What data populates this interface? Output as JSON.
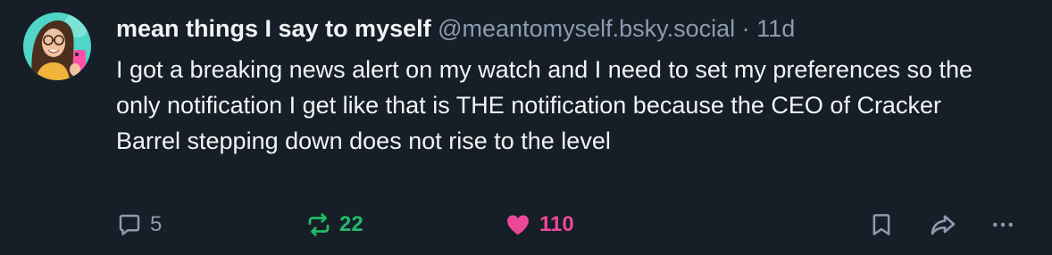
{
  "post": {
    "display_name": "mean things I say to myself",
    "handle": "@meantomyself.bsky.social",
    "separator": "·",
    "timestamp": "11d",
    "text": "I got a breaking news alert on my watch and I need to set my preferences so the only notification I get like that is THE notification because the CEO of Cracker Barrel stepping down does not rise to the level"
  },
  "actions": {
    "reply_count": "5",
    "repost_count": "22",
    "like_count": "110",
    "reply_icon": "speech-bubble-icon",
    "repost_icon": "repost-arrows-icon",
    "like_icon": "heart-filled-icon",
    "bookmark_icon": "bookmark-icon",
    "share_icon": "share-arrow-icon",
    "more_icon": "ellipsis-icon"
  },
  "colors": {
    "background": "#161e27",
    "text": "#f1f3f5",
    "muted": "#8c9bb0",
    "repost_active": "#20bc68",
    "like_active": "#ec4899"
  }
}
